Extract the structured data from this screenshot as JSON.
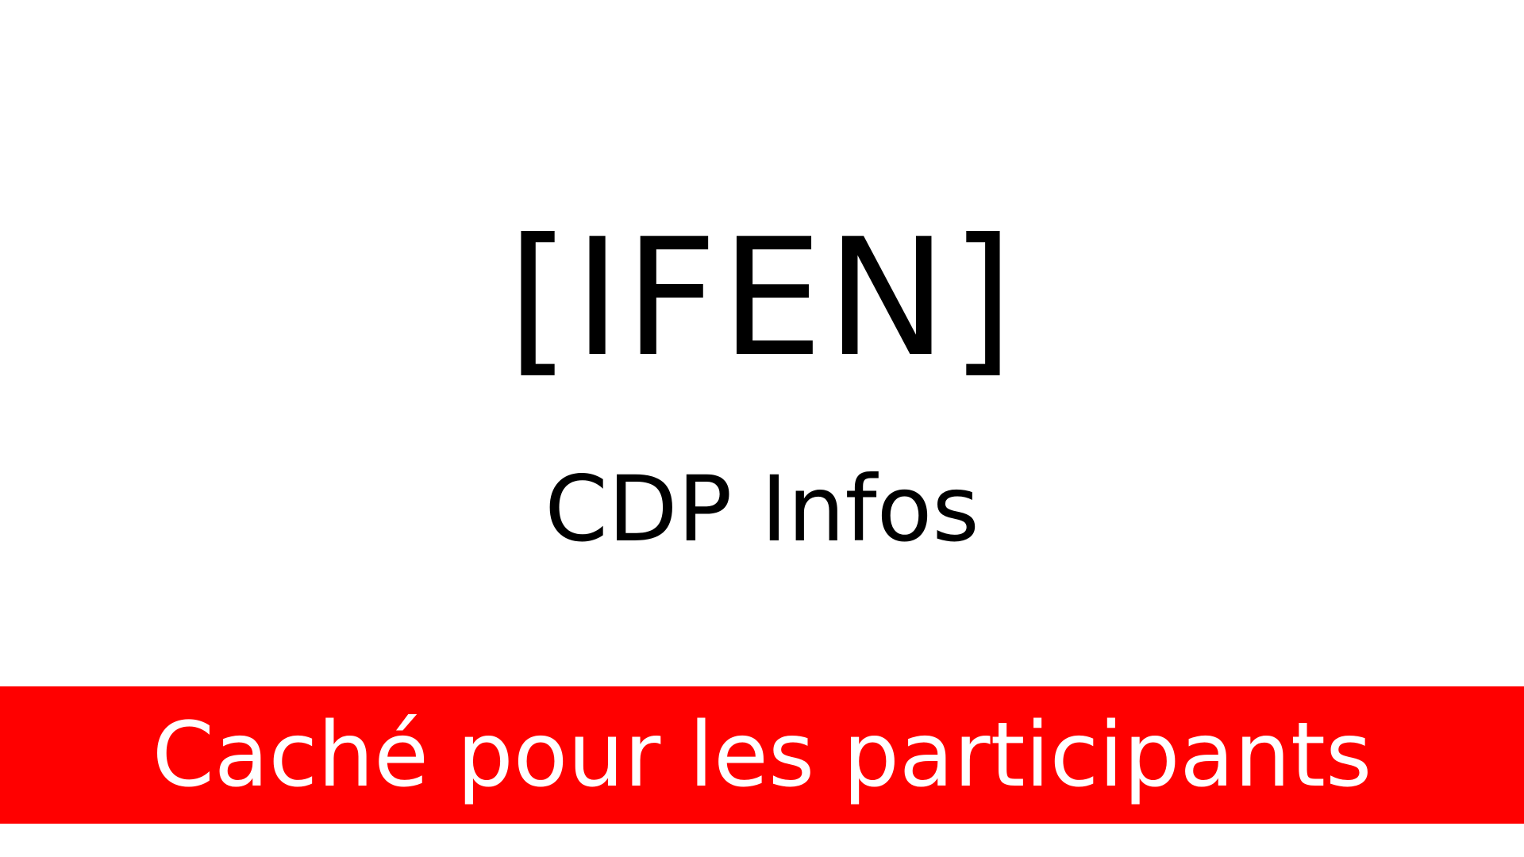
{
  "slide": {
    "logo_text": "[IFEN]",
    "subtitle": "CDP Infos",
    "banner_text": "Caché pour les participants"
  },
  "colors": {
    "background": "#ffffff",
    "text": "#000000",
    "banner_background": "#ff0000",
    "banner_text": "#ffffff"
  }
}
